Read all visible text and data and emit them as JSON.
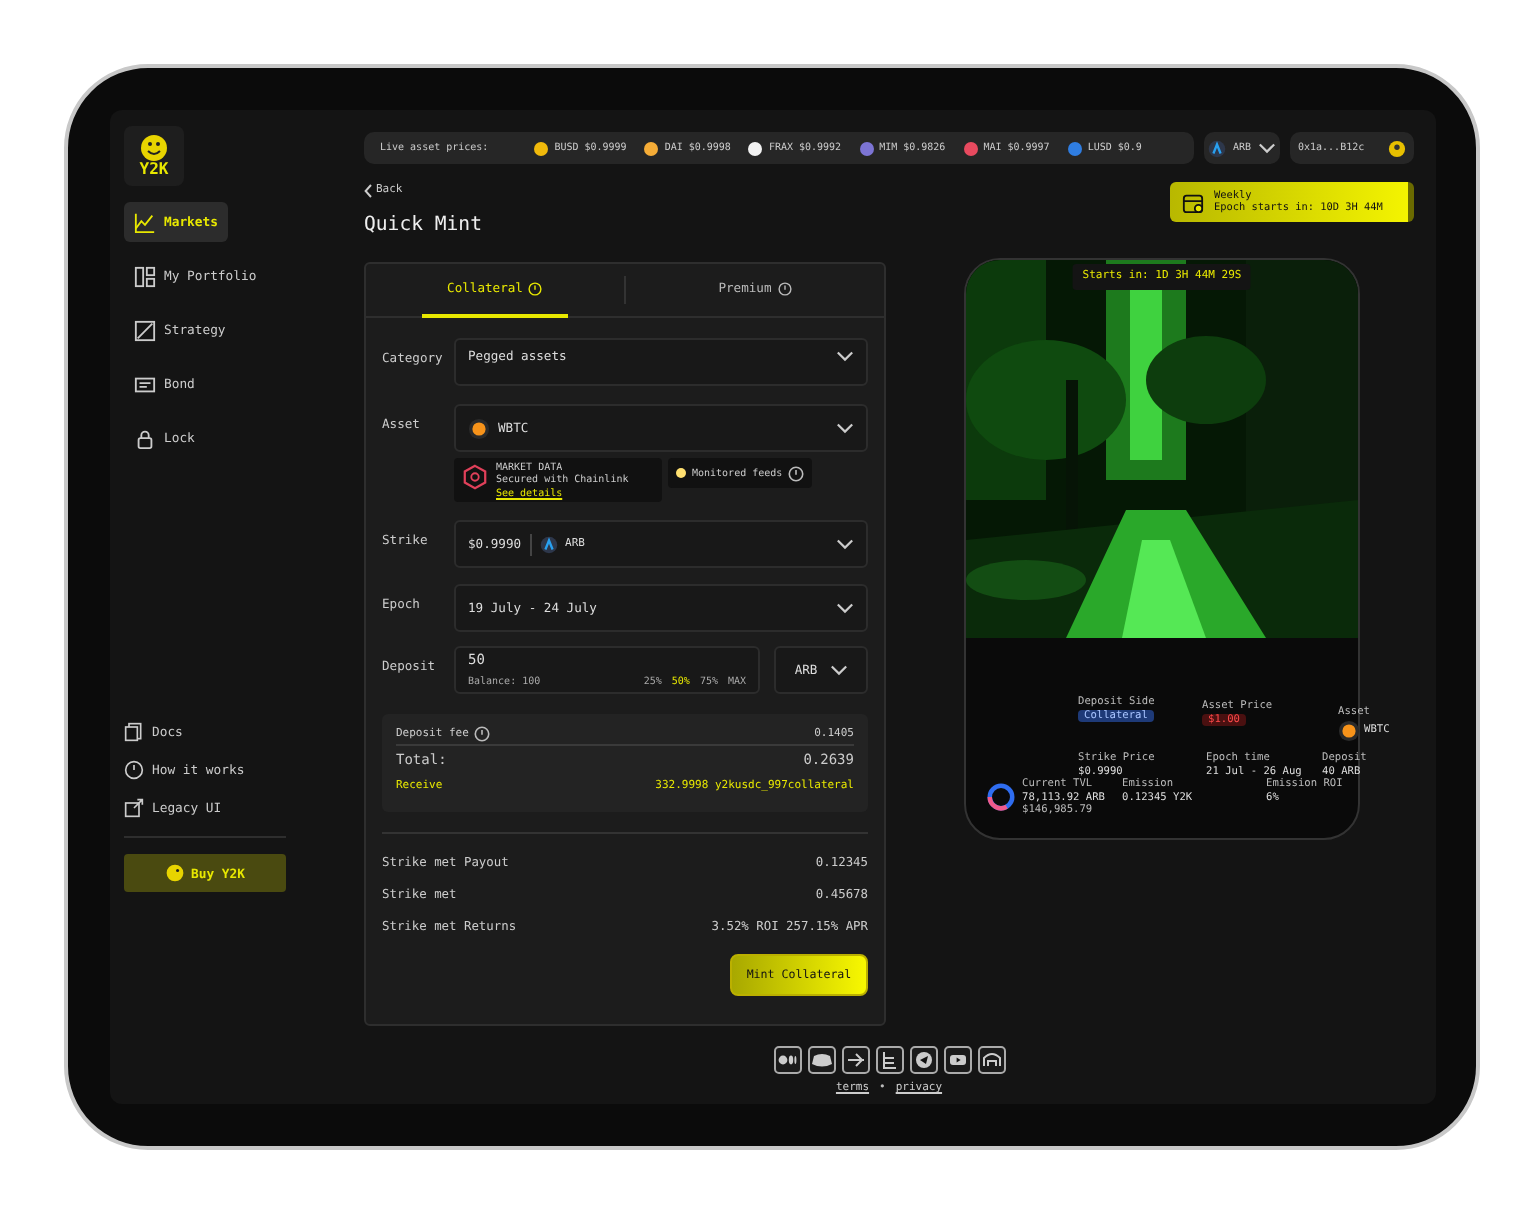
{
  "sidebar": {
    "logo": "Y2K",
    "items": [
      {
        "label": "Markets",
        "selected": true
      },
      {
        "label": "My Portfolio",
        "selected": false
      },
      {
        "label": "Strategy",
        "selected": false
      },
      {
        "label": "Bond",
        "selected": false
      },
      {
        "label": "Lock",
        "selected": false
      }
    ],
    "links": [
      {
        "label": "Docs"
      },
      {
        "label": "How it works"
      },
      {
        "label": "Legacy UI"
      }
    ],
    "buy_button": "Buy Y2K"
  },
  "topbar": {
    "ticker_label": "Live asset prices:",
    "prices": [
      {
        "symbol": "BUSD",
        "price": "$0.9999",
        "color": "#f0b90b"
      },
      {
        "symbol": "DAI",
        "price": "$0.9998",
        "color": "#f5ac37"
      },
      {
        "symbol": "FRAX",
        "price": "$0.9992",
        "color": "#f2f2f2"
      },
      {
        "symbol": "MIM",
        "price": "$0.9826",
        "color": "#7c74d4"
      },
      {
        "symbol": "MAI",
        "price": "$0.9997",
        "color": "#e84a5f"
      },
      {
        "symbol": "LUSD",
        "price": "$0.9",
        "color": "#2f7de1"
      }
    ],
    "network": "ARB",
    "wallet": "0x1a...B12c"
  },
  "back": "Back",
  "title": "Quick Mint",
  "banner": {
    "title": "Weekly",
    "subtitle": "Epoch starts in: 10D 3H 44M"
  },
  "form": {
    "tabs": [
      {
        "label": "Collateral",
        "selected": true
      },
      {
        "label": "Premium",
        "selected": false
      }
    ],
    "category": {
      "label": "Category",
      "value": "Pegged assets"
    },
    "asset": {
      "label": "Asset",
      "value": "WBTC"
    },
    "market_data": {
      "title": "MARKET DATA",
      "subtitle": "Secured with Chainlink",
      "link": "See details"
    },
    "feeds": "Monitored feeds",
    "strike": {
      "label": "Strike",
      "value": "$0.9990",
      "network": "ARB"
    },
    "epoch": {
      "label": "Epoch",
      "value": "19 July - 24 July"
    },
    "deposit": {
      "label": "Deposit",
      "value": "50",
      "balance": "Balance: 100",
      "token": "ARB",
      "presets": [
        {
          "label": "25%",
          "selected": false
        },
        {
          "label": "50%",
          "selected": true
        },
        {
          "label": "75%",
          "selected": false
        },
        {
          "label": "MAX",
          "selected": false
        }
      ]
    },
    "summary": {
      "fee_label": "Deposit fee",
      "fee": "0.1405",
      "total_label": "Total:",
      "total": "0.2639",
      "receive_label": "Receive",
      "receive": "332.9998 y2kusdc_997collateral"
    },
    "stats": [
      {
        "label": "Strike met Payout",
        "value": "0.12345"
      },
      {
        "label": "Strike met",
        "value": "0.45678"
      },
      {
        "label": "Strike met Returns",
        "value": "3.52% ROI 257.15% APR"
      }
    ],
    "submit": "Mint Collateral"
  },
  "preview": {
    "countdown": "Starts in: 1D 3H 44M 29S",
    "deposit_side": {
      "label": "Deposit Side",
      "value": "Collateral"
    },
    "asset_price": {
      "label": "Asset Price",
      "value": "$1.00"
    },
    "asset": {
      "label": "Asset",
      "value": "WBTC"
    },
    "strike_price": {
      "label": "Strike Price",
      "value": "$0.9990"
    },
    "epoch_time": {
      "label": "Epoch time",
      "value": "21 Jul - 26 Aug"
    },
    "deposit": {
      "label": "Deposit",
      "value": "40 ARB"
    },
    "tvl": {
      "label": "Current TVL",
      "value": "78,113.92 ARB",
      "usd": "$146,985.79"
    },
    "emission": {
      "label": "Emission",
      "value": "0.12345 Y2K"
    },
    "emission_roi": {
      "label": "Emission ROI",
      "value": "6%"
    }
  },
  "footer": {
    "links": [
      {
        "label": "terms"
      },
      {
        "label": "privacy"
      }
    ],
    "separator": "•"
  }
}
